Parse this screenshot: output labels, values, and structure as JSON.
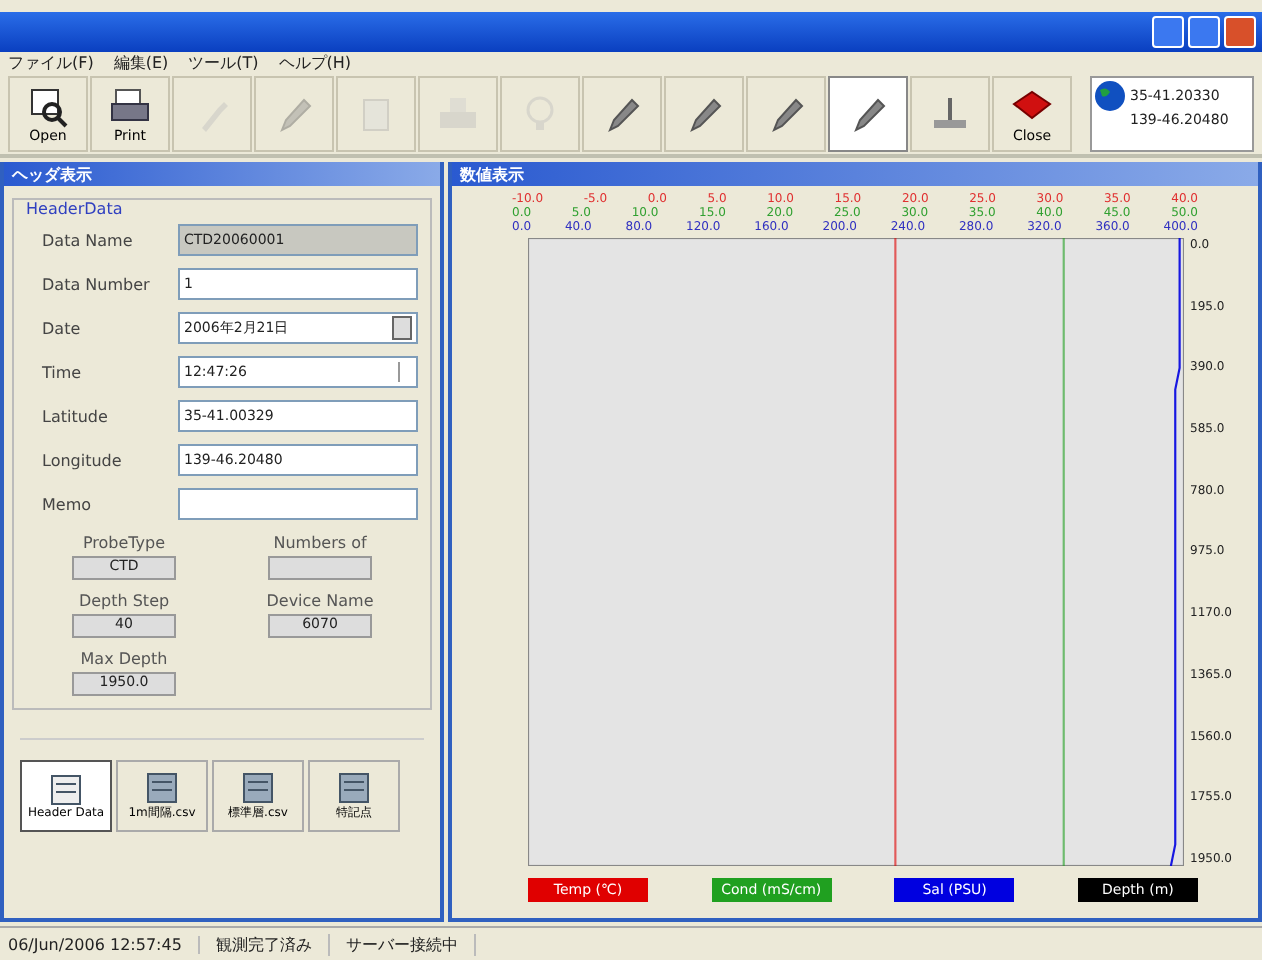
{
  "menu": [
    "ファイル(F)",
    "編集(E)",
    "ツール(T)",
    "ヘルプ(H)"
  ],
  "toolbar": [
    {
      "label": "Open",
      "disabled": false,
      "selected": false
    },
    {
      "label": "Print",
      "disabled": false,
      "selected": false
    },
    {
      "disabled": true,
      "selected": false
    },
    {
      "disabled": true,
      "selected": false
    },
    {
      "disabled": true,
      "selected": false
    },
    {
      "disabled": true,
      "selected": false
    },
    {
      "disabled": true,
      "selected": false
    },
    {
      "disabled": false,
      "selected": false
    },
    {
      "disabled": false,
      "selected": false
    },
    {
      "disabled": false,
      "selected": false
    },
    {
      "disabled": false,
      "selected": true
    },
    {
      "disabled": false,
      "selected": false
    },
    {
      "label": "Close",
      "disabled": false,
      "selected": false
    }
  ],
  "position": [
    "35-41.20330",
    "139-46.20480"
  ],
  "header_window": {
    "title": "ヘッダ表示",
    "group": "HeaderData",
    "fields": [
      {
        "label": "Data Name",
        "kind": "readonly",
        "value": "CTD20060001"
      },
      {
        "label": "Data Number",
        "kind": "text",
        "value": "1"
      },
      {
        "label": "Date",
        "kind": "date",
        "value": "2006年2月21日"
      },
      {
        "label": "Time",
        "kind": "time",
        "value": "12:47:26"
      },
      {
        "label": "Latitude",
        "kind": "text",
        "value": "35-41.00329"
      },
      {
        "label": "Longitude",
        "kind": "text",
        "value": "139-46.20480"
      },
      {
        "label": "Memo",
        "kind": "text"
      }
    ],
    "info": [
      {
        "label": "ProbeType",
        "value": "CTD"
      },
      {
        "label": "Numbers of"
      },
      {
        "label": "Depth Step",
        "value": "40"
      },
      {
        "label": "Device Name",
        "value": "6070"
      },
      {
        "label": "Max Depth",
        "value": "1950.0"
      }
    ],
    "tabs": [
      {
        "label": "Header Data",
        "selected": true
      },
      {
        "label": "1m間隔.csv",
        "selected": false
      },
      {
        "label": "標準層.csv",
        "selected": false
      },
      {
        "label": "特記点",
        "selected": false
      }
    ]
  },
  "chart_window": {
    "title": "数値表示",
    "scales": [
      {
        "color": "#e03030",
        "ticks": [
          "-10.0",
          "-5.0",
          "0.0",
          "5.0",
          "10.0",
          "15.0",
          "20.0",
          "25.0",
          "30.0",
          "35.0",
          "40.0"
        ]
      },
      {
        "color": "#30a030",
        "ticks": [
          "0.0",
          "5.0",
          "10.0",
          "15.0",
          "20.0",
          "25.0",
          "30.0",
          "35.0",
          "40.0",
          "45.0",
          "50.0"
        ]
      },
      {
        "color": "#3030c0",
        "ticks": [
          "0.0",
          "40.0",
          "80.0",
          "120.0",
          "160.0",
          "200.0",
          "240.0",
          "280.0",
          "320.0",
          "360.0",
          "400.0"
        ]
      }
    ],
    "depth_ticks": [
      "0.0",
      "195.0",
      "390.0",
      "585.0",
      "780.0",
      "975.0",
      "1170.0",
      "1365.0",
      "1560.0",
      "1755.0",
      "1950.0"
    ],
    "legend": [
      {
        "label": "Temp (℃)",
        "color": "#e00000"
      },
      {
        "label": "Cond (mS/cm)",
        "color": "#20a020"
      },
      {
        "label": "Sal (PSU)",
        "color": "#0000e0"
      },
      {
        "label": "Depth (m)",
        "color": "#000000"
      }
    ]
  },
  "status_bar": [
    "06/Jun/2006 12:57:45",
    "観測完了済み",
    "サーバー接続中"
  ]
}
